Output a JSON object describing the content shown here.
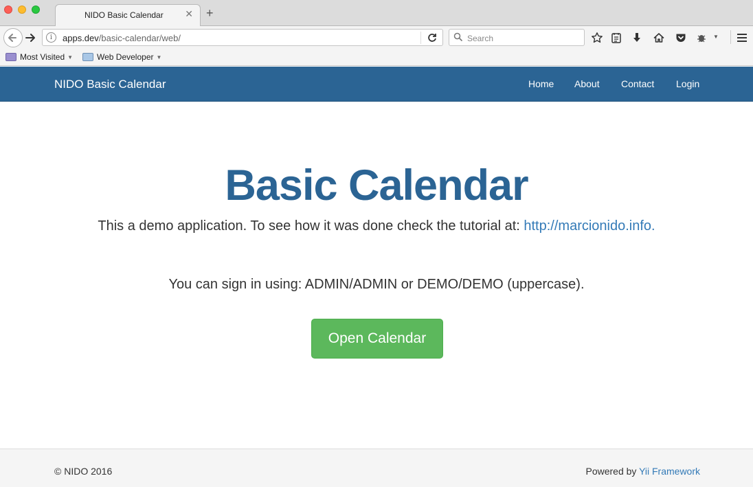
{
  "browser": {
    "tab_title": "NIDO Basic Calendar",
    "tab_close": "✕",
    "new_tab": "+",
    "url_host": "apps.dev",
    "url_path": "/basic-calendar/web/",
    "search_placeholder": "Search",
    "bookmarks": [
      {
        "label": "Most Visited"
      },
      {
        "label": "Web Developer"
      }
    ]
  },
  "site": {
    "brand": "NIDO Basic Calendar",
    "nav": [
      {
        "label": "Home"
      },
      {
        "label": "About"
      },
      {
        "label": "Contact"
      },
      {
        "label": "Login"
      }
    ]
  },
  "content": {
    "title": "Basic Calendar",
    "lead_text": "This a demo application. To see how it was done check the tutorial at: ",
    "lead_link": "http://marcionido.info.",
    "signin_text": "You can sign in using: ADMIN/ADMIN or DEMO/DEMO (uppercase).",
    "button_label": "Open Calendar"
  },
  "footer": {
    "copyright": "© NIDO 2016",
    "powered_prefix": "Powered by ",
    "powered_link": "Yii Framework"
  },
  "colors": {
    "navbar": "#2b6494",
    "button": "#5cb85c",
    "link": "#337ab7"
  }
}
